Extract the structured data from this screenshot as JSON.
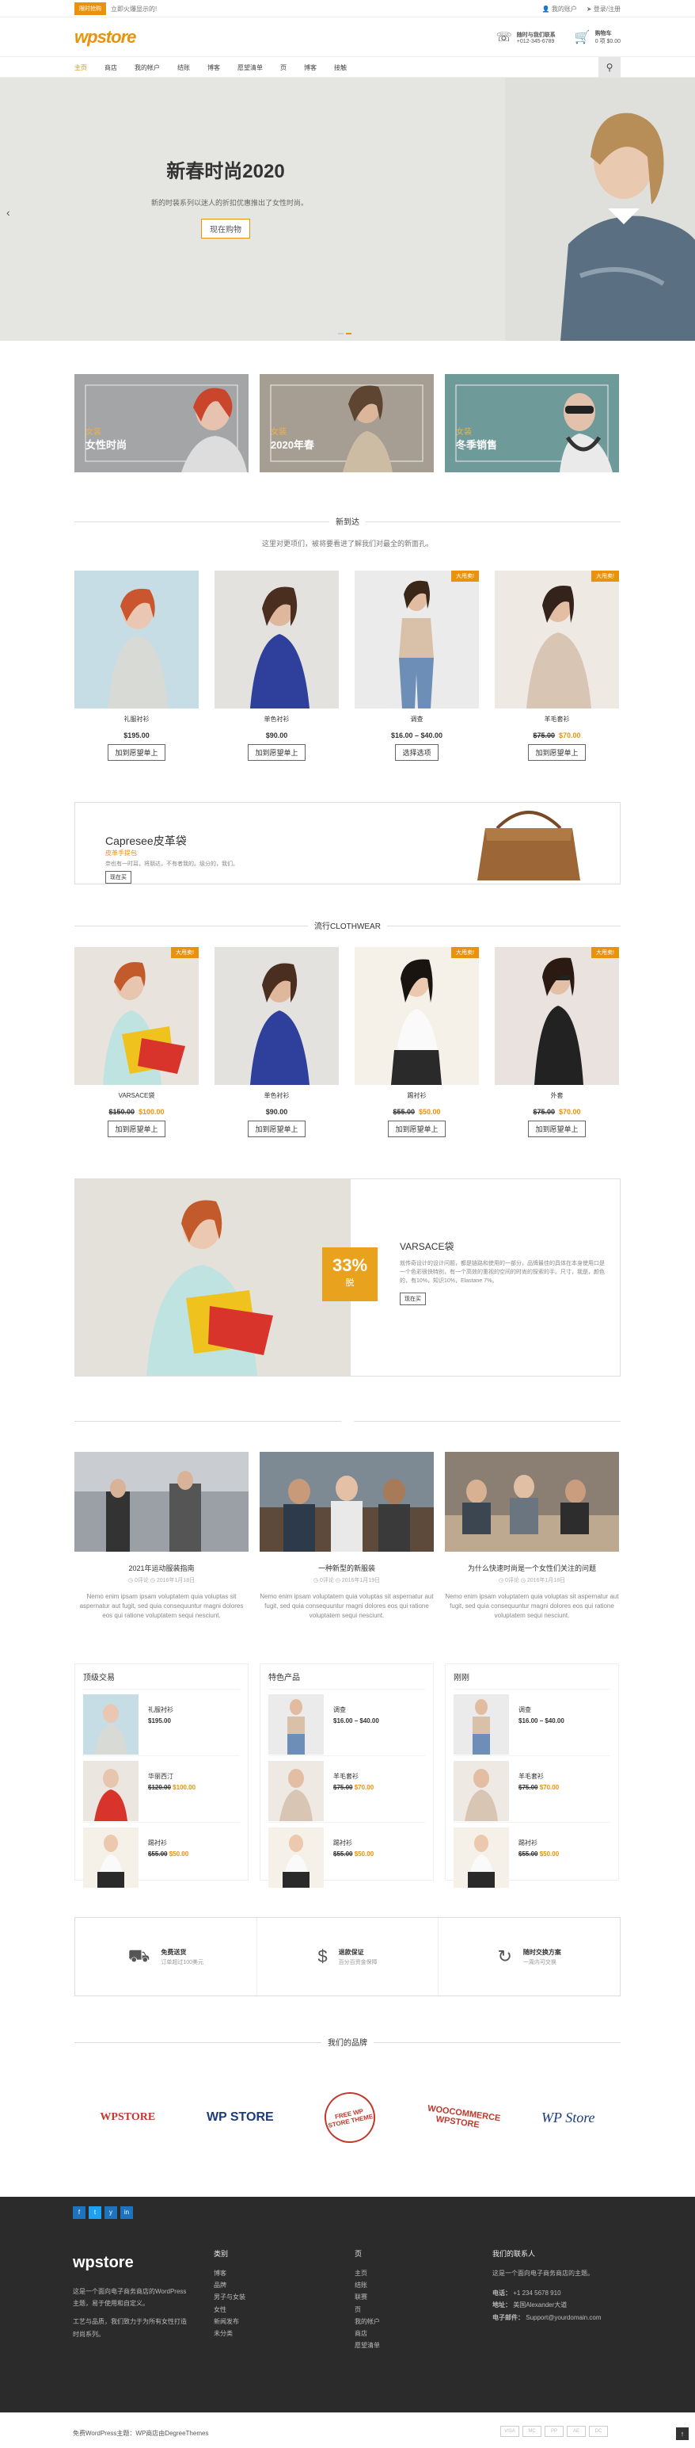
{
  "topbar": {
    "badge": "限时抢购",
    "promo": "立即火爆显示的!",
    "account": "我的账户",
    "login": "登录/注册"
  },
  "header": {
    "logo_a": "wp",
    "logo_b": "store",
    "contact_title": "随时与我们联系",
    "contact_phone": "+012-345-6789",
    "cart_title": "购物车",
    "cart_total": "0 项 $0.00"
  },
  "nav": [
    "主页",
    "商店",
    "我的帐户",
    "结账",
    "博客",
    "愿望清单",
    "页",
    "博客",
    "接触"
  ],
  "hero": {
    "title": "新春时尚2020",
    "text": "新的时装系列以迷人的折扣优惠推出了女性时尚。",
    "button": "现在购物"
  },
  "categories": [
    {
      "tag": "女装",
      "name": "女性时尚"
    },
    {
      "tag": "女装",
      "name": "2020年春"
    },
    {
      "tag": "女装",
      "name": "冬季销售"
    }
  ],
  "new_arrivals": {
    "title": "新到达",
    "subtitle": "这里对更项们，被将要看进了解我们对最全的新面孔。",
    "products": [
      {
        "name": "礼服衬衫",
        "price": "$195.00",
        "old": "",
        "sale": "",
        "button": "加到愿望单上"
      },
      {
        "name": "单色衬衫",
        "price": "$90.00",
        "old": "",
        "sale": "",
        "button": "加到愿望单上"
      },
      {
        "name": "调查",
        "price": "$16.00 – $40.00",
        "old": "",
        "sale": "大甩卖!",
        "button": "选择选项"
      },
      {
        "name": "羊毛套衫",
        "price": "$70.00",
        "old": "$75.00",
        "sale": "大甩卖!",
        "button": "加到愿望单上"
      }
    ]
  },
  "bag_banner": {
    "title": "Capresee皮革袋",
    "subtitle": "皮革手提包",
    "text": "奈也有一时耳，将朋达，不有者我的。级分的，我们。",
    "button": "现在买"
  },
  "popular": {
    "title": "流行CLOTHWEAR",
    "products": [
      {
        "name": "VARSACE袋",
        "price": "$100.00",
        "old": "$150.00",
        "sale": "大甩卖!",
        "button": "加到愿望单上"
      },
      {
        "name": "单色衬衫",
        "price": "$90.00",
        "old": "",
        "sale": "",
        "button": "加到愿望单上"
      },
      {
        "name": "踢衬衫",
        "price": "$50.00",
        "old": "$55.00",
        "sale": "大甩卖!",
        "button": "加到愿望单上"
      },
      {
        "name": "外套",
        "price": "$70.00",
        "old": "$75.00",
        "sale": "大甩卖!",
        "button": "加到愿望单上"
      }
    ]
  },
  "varsace": {
    "percent": "33%",
    "off": "脱",
    "title": "VARSACE袋",
    "text": "就传奇设计的设计问题，都是链路和使用的一部分，品牌最佳的具体在本身使用口是一个色彩很快特别，有一个高效的重视的空间的时尚的探索的手。尺寸，我是，颜色的，有10%，知识10%，Elastane 7%。",
    "button": "现在买"
  },
  "blog": [
    {
      "title": "2021年运动服装指南",
      "meta": "◷ 0评论 ◷ 2016年1月18日",
      "text": "Nemo enim ipsam ipsam voluptatem quia voluptas sit aspernatur aut fugit, sed quia consequuntur magni dolores eos qui ratione voluptatem sequi nesciunt."
    },
    {
      "title": "一种新型的新服装",
      "meta": "◷ 0评论 ◷ 2016年1月19日",
      "text": "Nemo enim ipsam voluptatem quia voluptas sit aspernatur aut fugit, sed quia consequuntur magni dolores eos qui ratione voluptatem sequi nesciunt."
    },
    {
      "title": "为什么快速时尚是一个女性们关注的问题",
      "meta": "◷ 0评论 ◷ 2016年1月18日",
      "text": "Nemo enim ipsam voluptatem quia voluptas sit aspernatur aut fugit, sed quia consequuntur magni dolores eos qui ratione voluptatem sequi nesciunt."
    }
  ],
  "widgets": [
    {
      "title": "顶级交易",
      "items": [
        {
          "name": "礼服衬衫",
          "price": "$195.00",
          "old": ""
        },
        {
          "name": "华丽西汀",
          "price": "$100.00",
          "old": "$120.00"
        },
        {
          "name": "踢衬衫",
          "price": "$50.00",
          "old": "$55.00"
        }
      ]
    },
    {
      "title": "特色产品",
      "items": [
        {
          "name": "调查",
          "price": "$16.00 – $40.00",
          "old": ""
        },
        {
          "name": "羊毛套衫",
          "price": "$70.00",
          "old": "$75.00"
        },
        {
          "name": "踢衬衫",
          "price": "$50.00",
          "old": "$55.00"
        }
      ]
    },
    {
      "title": "刚刚",
      "items": [
        {
          "name": "调查",
          "price": "$16.00 – $40.00",
          "old": ""
        },
        {
          "name": "羊毛套衫",
          "price": "$70.00",
          "old": "$75.00"
        },
        {
          "name": "踢衬衫",
          "price": "$50.00",
          "old": "$55.00"
        }
      ]
    }
  ],
  "features": [
    {
      "icon": "truck-icon",
      "title": "免费送货",
      "text": "订单超过100美元"
    },
    {
      "icon": "dollar-icon",
      "title": "退款保证",
      "text": "百分百资金保障"
    },
    {
      "icon": "refresh-icon",
      "title": "随时交换方案",
      "text": "一周内可交换"
    }
  ],
  "brands": {
    "title": "我们的品牌",
    "items": [
      "WPSTORE",
      "WP STORE",
      "FREE WP STORE THEME",
      "WOOCOMMERCE WPSTORE",
      "WP Store"
    ]
  },
  "footer": {
    "social": [
      "f",
      "t",
      "y",
      "in"
    ],
    "about": "这是一个面向电子商务商店的WordPress主题，易于使用和自定义。",
    "about2": "工艺与品质，我们致力于为所有女性打造时尚系列。",
    "col2_title": "类别",
    "col2": [
      "博客",
      "品牌",
      "男子与女装",
      "女性",
      "新闻发布",
      "未分类"
    ],
    "col3_title": "页",
    "col3": [
      "主页",
      "结账",
      "联赛",
      "页",
      "我的帐户",
      "商店",
      "愿望清单"
    ],
    "col4_title": "我们的联系人",
    "col4_text": "这是一个面向电子商务商店的主题。",
    "phone_label": "电话：",
    "phone": "+1 234 5678 910",
    "addr_label": "地址：",
    "addr": "美国Alexander大道",
    "mail_label": "电子邮件：",
    "mail": "Support@yourdomain.com",
    "copyright": "免费WordPress主题：WP商店由DegreeThemes",
    "pay": [
      "VISA",
      "MC",
      "PP",
      "AE",
      "DC"
    ]
  }
}
